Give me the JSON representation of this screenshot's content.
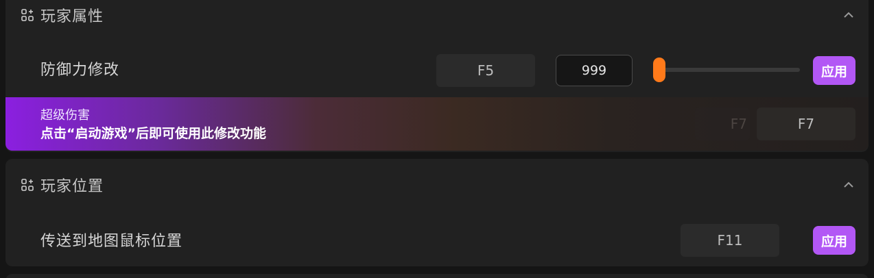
{
  "sections": [
    {
      "title": "玩家属性",
      "icon": "apps-add-icon",
      "collapse_icon": "chevron-up-icon",
      "rows": [
        {
          "label": "防御力修改",
          "hotkey": "F5",
          "value": "999",
          "slider_fraction": 0.0,
          "slider_color": "#ff7a1a",
          "apply_label": "应用"
        }
      ],
      "promo": {
        "title": "超级伤害",
        "text": "点击“启动游戏”后即可使用此修改功能",
        "ghost_hotkey": "F7",
        "hotkey": "F7"
      }
    },
    {
      "title": "玩家位置",
      "icon": "apps-add-icon",
      "collapse_icon": "chevron-up-icon",
      "rows": [
        {
          "label": "传送到地图鼠标位置",
          "hotkey": "F11",
          "apply_label": "应用"
        }
      ]
    }
  ],
  "colors": {
    "accent": "#b257f5",
    "slider": "#ff7a1a",
    "panel": "#212121",
    "background": "#151515"
  }
}
